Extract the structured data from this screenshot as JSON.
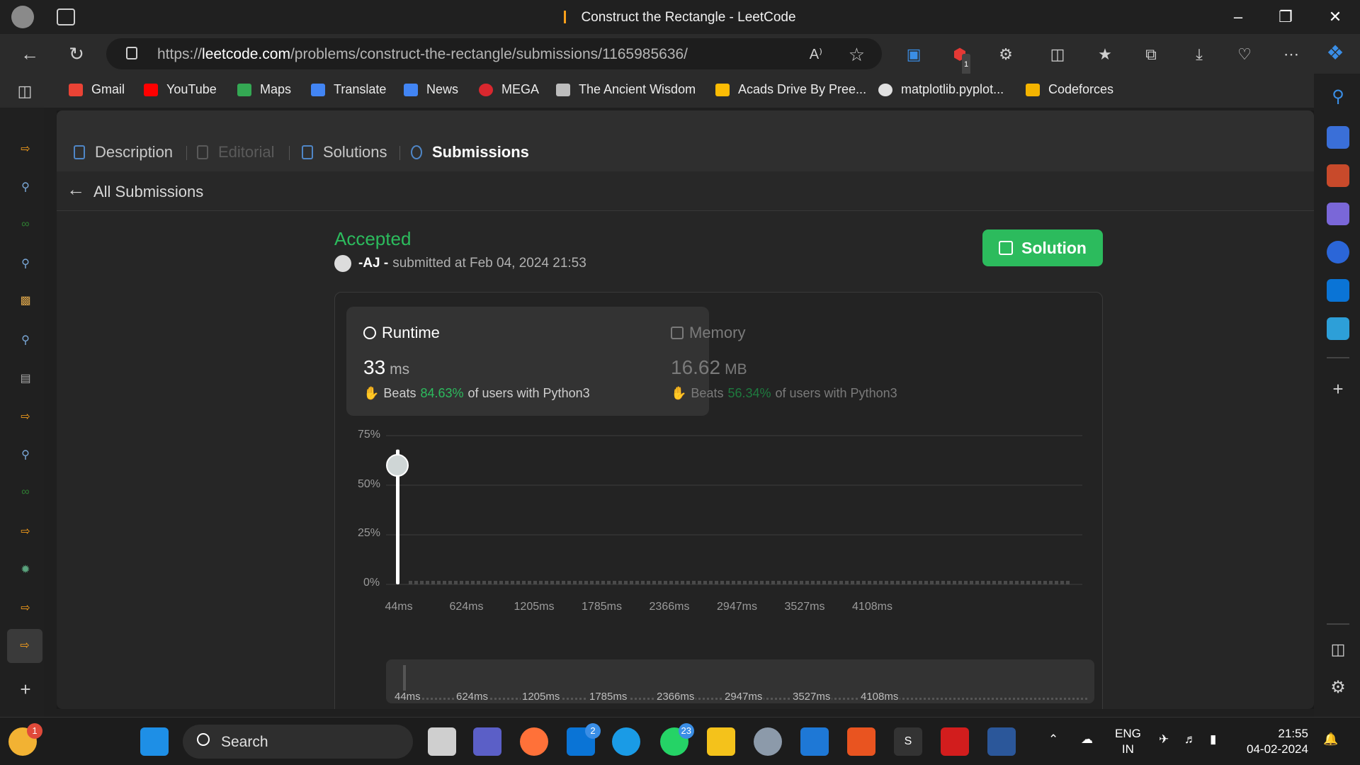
{
  "window": {
    "title": "Construct the Rectangle - LeetCode"
  },
  "browser": {
    "url_prefix": "https://",
    "url_domain": "leetcode.com",
    "url_path": "/problems/construct-the-rectangle/submissions/1165985636/",
    "read_aloud": "A⁾",
    "bookmarks": [
      {
        "label": "Gmail",
        "color": "#ea4335"
      },
      {
        "label": "YouTube",
        "color": "#ff0000"
      },
      {
        "label": "Maps",
        "color": "#34a853"
      },
      {
        "label": "Translate",
        "color": "#4285f4"
      },
      {
        "label": "News",
        "color": "#4285f4"
      },
      {
        "label": "MEGA",
        "color": "#d9272e"
      },
      {
        "label": "The Ancient Wisdom",
        "color": "#bdbdbd"
      },
      {
        "label": "Acads Drive By Pree...",
        "color": "#fbbc04"
      },
      {
        "label": "matplotlib.pyplot...",
        "color": "#e0e0e0"
      },
      {
        "label": "Codeforces",
        "color": "#f4b400"
      }
    ],
    "extension_badge": "1"
  },
  "problem_tabs": [
    {
      "label": "Description"
    },
    {
      "label": "Editorial"
    },
    {
      "label": "Solutions"
    },
    {
      "label": "Submissions"
    }
  ],
  "back_link": "All Submissions",
  "submission": {
    "status": "Accepted",
    "user": "-AJ -",
    "submitted_text": "submitted at Feb 04, 2024 21:53",
    "solution_button": "Solution"
  },
  "runtime": {
    "label": "Runtime",
    "value": "33",
    "unit": "ms",
    "beats_prefix": "Beats",
    "beats_pct": "84.63%",
    "beats_suffix": "of users with Python3"
  },
  "memory": {
    "label": "Memory",
    "value": "16.62",
    "unit": "MB",
    "beats_prefix": "Beats",
    "beats_pct": "56.34%",
    "beats_suffix": "of users with Python3"
  },
  "chart_data": {
    "type": "bar",
    "xlabel": "",
    "ylabel": "",
    "yticks": [
      "75%",
      "50%",
      "25%",
      "0%"
    ],
    "ylim": [
      0,
      75
    ],
    "x_tick_labels": [
      "44ms",
      "624ms",
      "1205ms",
      "1785ms",
      "2366ms",
      "2947ms",
      "3527ms",
      "4108ms"
    ],
    "series": [
      {
        "categories": [
          "44ms"
        ],
        "values": [
          68
        ]
      }
    ],
    "highlight": {
      "x": "44ms",
      "value": 60
    },
    "colors": {
      "bar": "#ffffff",
      "grid": "#3c3c3c",
      "tail": "#4a4a4a"
    }
  },
  "brush_labels": [
    "44ms",
    "624ms",
    "1205ms",
    "1785ms",
    "2366ms",
    "2947ms",
    "3527ms",
    "4108ms"
  ],
  "taskbar": {
    "search_placeholder": "Search",
    "weather_badge": "1",
    "mail_badge": "2",
    "whatsapp_badge": "23",
    "lang_line1": "ENG",
    "lang_line2": "IN",
    "time": "21:55",
    "date": "04-02-2024"
  }
}
